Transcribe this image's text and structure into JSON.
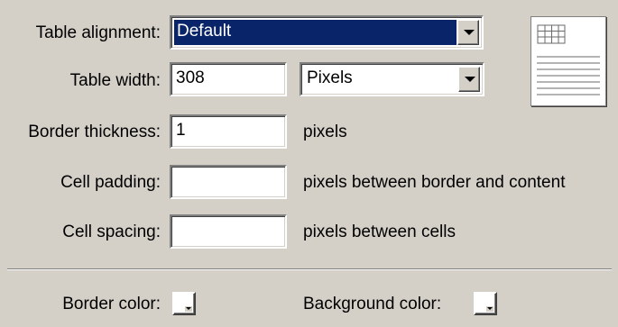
{
  "table_alignment": {
    "label": "Table alignment:",
    "value": "Default"
  },
  "table_width": {
    "label": "Table width:",
    "value": "308",
    "unit": "Pixels"
  },
  "border_thickness": {
    "label": "Border thickness:",
    "value": "1",
    "hint": "pixels"
  },
  "cell_padding": {
    "label": "Cell padding:",
    "value": "",
    "hint": "pixels between border and content"
  },
  "cell_spacing": {
    "label": "Cell spacing:",
    "value": "",
    "hint": "pixels between cells"
  },
  "colors": {
    "border_label": "Border color:",
    "background_label": "Background color:"
  },
  "icons": {
    "preview": "table-preview-icon"
  },
  "theme": {
    "background": "#d4d0c8",
    "selection": "#0a246a"
  }
}
